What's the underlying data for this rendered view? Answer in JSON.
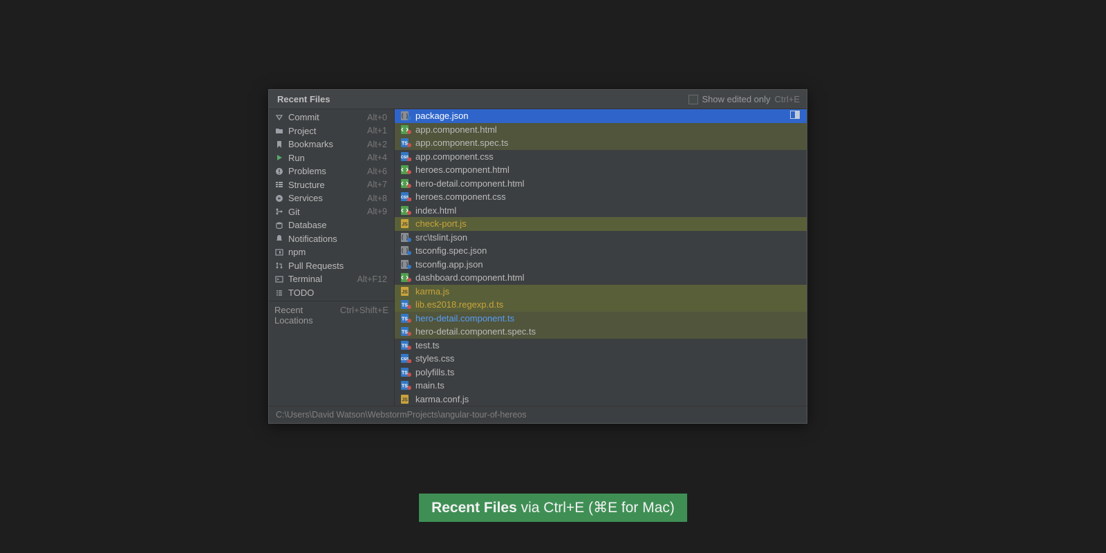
{
  "header": {
    "title": "Recent Files",
    "show_edited_only_label": "Show edited only",
    "show_edited_shortcut": "Ctrl+E"
  },
  "tools": [
    {
      "icon": "commit",
      "label": "Commit",
      "shortcut": "Alt+0"
    },
    {
      "icon": "project",
      "label": "Project",
      "shortcut": "Alt+1"
    },
    {
      "icon": "bookmark",
      "label": "Bookmarks",
      "shortcut": "Alt+2"
    },
    {
      "icon": "run",
      "label": "Run",
      "shortcut": "Alt+4"
    },
    {
      "icon": "problems",
      "label": "Problems",
      "shortcut": "Alt+6"
    },
    {
      "icon": "structure",
      "label": "Structure",
      "shortcut": "Alt+7"
    },
    {
      "icon": "services",
      "label": "Services",
      "shortcut": "Alt+8"
    },
    {
      "icon": "git",
      "label": "Git",
      "shortcut": "Alt+9"
    },
    {
      "icon": "database",
      "label": "Database",
      "shortcut": ""
    },
    {
      "icon": "notify",
      "label": "Notifications",
      "shortcut": ""
    },
    {
      "icon": "npm",
      "label": "npm",
      "shortcut": ""
    },
    {
      "icon": "pullreq",
      "label": "Pull Requests",
      "shortcut": ""
    },
    {
      "icon": "terminal",
      "label": "Terminal",
      "shortcut": "Alt+F12"
    },
    {
      "icon": "todo",
      "label": "TODO",
      "shortcut": ""
    }
  ],
  "locations": {
    "label": "Recent Locations",
    "shortcut": "Ctrl+Shift+E"
  },
  "files": [
    {
      "icon": "json",
      "name": "package.json",
      "color": "",
      "selected": true,
      "hl": ""
    },
    {
      "icon": "html",
      "name": "app.component.html",
      "color": "",
      "selected": false,
      "hl": "green"
    },
    {
      "icon": "ts",
      "name": "app.component.spec.ts",
      "color": "",
      "selected": false,
      "hl": "green"
    },
    {
      "icon": "css",
      "name": "app.component.css",
      "color": "",
      "selected": false,
      "hl": ""
    },
    {
      "icon": "html",
      "name": "heroes.component.html",
      "color": "",
      "selected": false,
      "hl": ""
    },
    {
      "icon": "html",
      "name": "hero-detail.component.html",
      "color": "",
      "selected": false,
      "hl": ""
    },
    {
      "icon": "css",
      "name": "heroes.component.css",
      "color": "",
      "selected": false,
      "hl": ""
    },
    {
      "icon": "html",
      "name": "index.html",
      "color": "",
      "selected": false,
      "hl": ""
    },
    {
      "icon": "js",
      "name": "check-port.js",
      "color": "orange",
      "selected": false,
      "hl": "olive"
    },
    {
      "icon": "json",
      "name": "src\\tslint.json",
      "color": "",
      "selected": false,
      "hl": ""
    },
    {
      "icon": "json",
      "name": "tsconfig.spec.json",
      "color": "",
      "selected": false,
      "hl": ""
    },
    {
      "icon": "json",
      "name": "tsconfig.app.json",
      "color": "",
      "selected": false,
      "hl": ""
    },
    {
      "icon": "html",
      "name": "dashboard.component.html",
      "color": "",
      "selected": false,
      "hl": ""
    },
    {
      "icon": "js",
      "name": "karma.js",
      "color": "orange",
      "selected": false,
      "hl": "olive"
    },
    {
      "icon": "ts",
      "name": "lib.es2018.regexp.d.ts",
      "color": "orange",
      "selected": false,
      "hl": "olive"
    },
    {
      "icon": "ts",
      "name": "hero-detail.component.ts",
      "color": "blue",
      "selected": false,
      "hl": "green"
    },
    {
      "icon": "ts",
      "name": "hero-detail.component.spec.ts",
      "color": "",
      "selected": false,
      "hl": "green"
    },
    {
      "icon": "ts",
      "name": "test.ts",
      "color": "",
      "selected": false,
      "hl": ""
    },
    {
      "icon": "css",
      "name": "styles.css",
      "color": "",
      "selected": false,
      "hl": ""
    },
    {
      "icon": "ts",
      "name": "polyfills.ts",
      "color": "",
      "selected": false,
      "hl": ""
    },
    {
      "icon": "ts",
      "name": "main.ts",
      "color": "",
      "selected": false,
      "hl": ""
    },
    {
      "icon": "js",
      "name": "karma.conf.js",
      "color": "",
      "selected": false,
      "hl": ""
    }
  ],
  "footer": {
    "path": "C:\\Users\\David Watson\\WebstormProjects\\angular-tour-of-hereos"
  },
  "caption": {
    "bold": "Recent Files",
    "rest": " via Ctrl+E (⌘E for Mac)"
  }
}
